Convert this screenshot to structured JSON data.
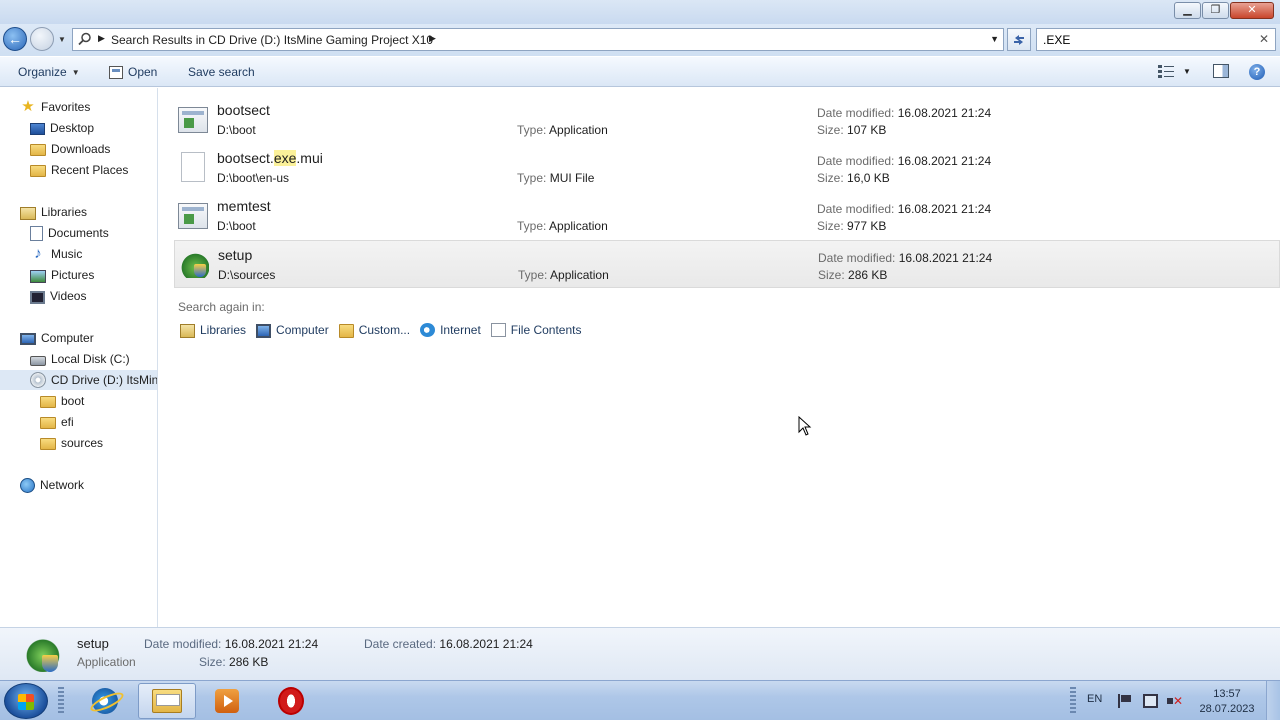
{
  "window": {
    "minimize_glyph": "▁",
    "maximize_glyph": "❐",
    "close_glyph": "✕"
  },
  "address": {
    "breadcrumb": "Search Results in CD Drive (D:) ItsMine Gaming Project X10",
    "search_value": ".EXE"
  },
  "toolbar": {
    "organize": "Organize",
    "open": "Open",
    "save_search": "Save search",
    "help": "?"
  },
  "nav": {
    "favorites": "Favorites",
    "desktop": "Desktop",
    "downloads": "Downloads",
    "recent_places": "Recent Places",
    "libraries": "Libraries",
    "documents": "Documents",
    "music": "Music",
    "pictures": "Pictures",
    "videos": "Videos",
    "computer": "Computer",
    "local_disk": "Local Disk (C:)",
    "cd_drive": "CD Drive (D:) ItsMine",
    "boot": "boot",
    "efi": "efi",
    "sources": "sources",
    "network": "Network"
  },
  "results": [
    {
      "name": "bootsect",
      "path": "D:\\boot",
      "type": "Application",
      "date": "16.08.2021 21:24",
      "size": "107 KB"
    },
    {
      "name_pre": "bootsect.",
      "name_hl": "exe",
      "name_post": ".mui",
      "path": "D:\\boot\\en-us",
      "type": "MUI File",
      "date": "16.08.2021 21:24",
      "size": "16,0 KB"
    },
    {
      "name": "memtest",
      "path": "D:\\boot",
      "type": "Application",
      "date": "16.08.2021 21:24",
      "size": "977 KB"
    },
    {
      "name": "setup",
      "path": "D:\\sources",
      "type": "Application",
      "date": "16.08.2021 21:24",
      "size": "286 KB"
    }
  ],
  "labels": {
    "type": "Type:",
    "date_modified": "Date modified:",
    "size": "Size:",
    "date_created": "Date created:"
  },
  "search_again": {
    "label": "Search again in:",
    "libraries": "Libraries",
    "computer": "Computer",
    "custom": "Custom...",
    "internet": "Internet",
    "file_contents": "File Contents"
  },
  "details": {
    "name": "setup",
    "type": "Application",
    "date_modified": "16.08.2021 21:24",
    "date_created": "16.08.2021 21:24",
    "size": "286 KB"
  },
  "taskbar": {
    "language": "EN",
    "time": "13:57",
    "date": "28.07.2023"
  }
}
